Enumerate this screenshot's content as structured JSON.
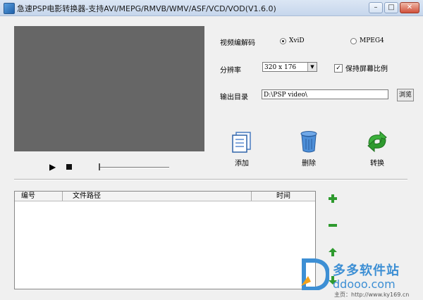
{
  "window": {
    "title": "急速PSP电影转换器-支持AVI/MEPG/RMVB/WMV/ASF/VCD/VOD(V1.6.0)"
  },
  "settings": {
    "codec_label": "视频编解码",
    "codec_xvid": "XviD",
    "codec_mpeg4": "MPEG4",
    "resolution_label": "分辨率",
    "resolution_value": "320 x 176",
    "keep_ratio_label": "保持屏幕比例",
    "output_label": "输出目录",
    "output_value": "D:\\PSP video\\",
    "browse_label": "浏览"
  },
  "actions": {
    "add": "添加",
    "delete": "删除",
    "convert": "转换"
  },
  "list": {
    "columns": [
      "编号",
      "文件路径",
      "时间"
    ]
  },
  "watermark": {
    "brand": "多多软件站",
    "domain": "ddooo.com",
    "homepage": "主页：http://www.ky169.cn"
  },
  "colors": {
    "video_bg": "#666666",
    "green": "#2e9a2e",
    "brand_blue": "#3d8fd4"
  }
}
